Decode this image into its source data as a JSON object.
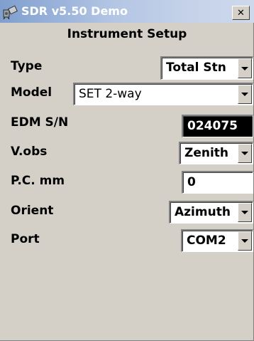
{
  "window": {
    "title": "SDR v5.50 Demo",
    "app_icon": "app-icon",
    "close_label": "✕"
  },
  "heading": "Instrument Setup",
  "form": {
    "type": {
      "label": "Type",
      "value": "Total Stn"
    },
    "model": {
      "label": "Model",
      "value": "SET 2-way"
    },
    "edm_sn": {
      "label": "EDM S/N",
      "value": "024075"
    },
    "vobs": {
      "label": "V.obs",
      "value": "Zenith"
    },
    "pc_mm": {
      "label": "P.C. mm",
      "value": "0"
    },
    "orient": {
      "label": "Orient",
      "value": "Azimuth"
    },
    "port": {
      "label": "Port",
      "value": "COM2"
    }
  },
  "colors": {
    "titlebar_start": "#7f9fcf",
    "titlebar_end": "#cdd8ec",
    "face": "#d4d0c8",
    "selected_field_bg": "#000000"
  }
}
